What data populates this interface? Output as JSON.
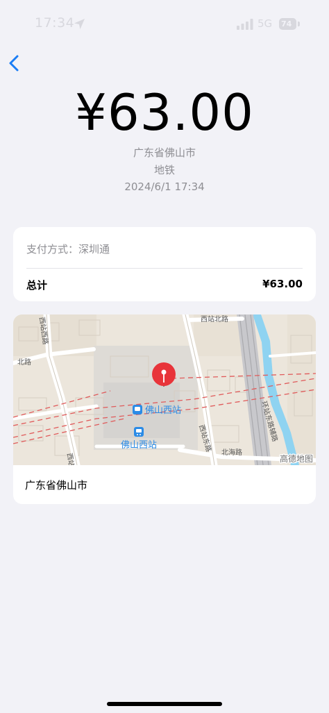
{
  "status_bar": {
    "time": "17:34",
    "network": "5G",
    "battery": "74"
  },
  "header": {
    "amount": "¥63.00",
    "region": "广东省佛山市",
    "category": "地铁",
    "datetime": "2024/6/1 17:34"
  },
  "payment": {
    "method": "支付方式：深圳通",
    "total_label": "总计",
    "total_value": "¥63.00"
  },
  "map": {
    "station_label": "佛山西站",
    "metro_label": "佛山西站",
    "road_north": "西站北路",
    "road_west_top": "西站西路",
    "road_west_bottom": "西站西路",
    "road_east": "西站东路",
    "road_ring": "环站东路辅路",
    "road_left_edge": "北路",
    "road_south": "北海路",
    "watermark": "高德地图",
    "pin_color": "#e8343a",
    "water_color": "#8fd3f1",
    "location_text": "广东省佛山市"
  }
}
